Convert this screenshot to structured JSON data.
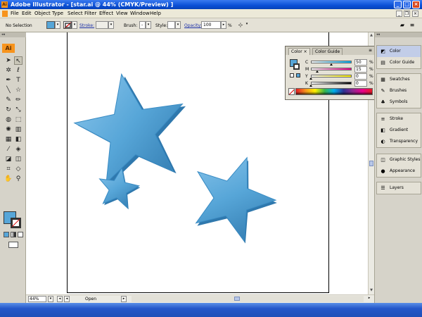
{
  "window": {
    "title": "Adobe Illustrator - [star.ai @ 44% (CMYK/Preview) ]",
    "app_icon_label": "Ai",
    "minimize": "_",
    "maximize": "□",
    "close": "×"
  },
  "menu": {
    "items": [
      "File",
      "Edit",
      "Object",
      "Type",
      "Select",
      "Filter",
      "Effect",
      "View",
      "Window",
      "Help"
    ],
    "doc_minimize": "_",
    "doc_restore": "❐",
    "doc_close": "×"
  },
  "control": {
    "selection": "No Selection",
    "fill_color": "#57a6d8",
    "stroke_label": "Stroke:",
    "brush_label": "Brush:",
    "brush_value": "-",
    "style_label": "Style:",
    "opacity_label": "Opacity:",
    "opacity_value": "100",
    "opacity_unit": "%"
  },
  "tools": {
    "panel_badge": "Ai",
    "collapse": "◂◂"
  },
  "color_panel": {
    "tabs": [
      "Color",
      "Color Guide"
    ],
    "menu_icon": "≡",
    "fill_color": "#57a6d8",
    "channels": [
      {
        "label": "C",
        "value": "50",
        "fraction": 0.5,
        "color": "#00aeef"
      },
      {
        "label": "M",
        "value": "15",
        "fraction": 0.15,
        "color": "#ec008c"
      },
      {
        "label": "Y",
        "value": "0",
        "fraction": 0.0,
        "color": "#fff200"
      },
      {
        "label": "K",
        "value": "0",
        "fraction": 0.0,
        "color": "#000000"
      }
    ],
    "unit": "%"
  },
  "dock": {
    "collapse": "◂◂",
    "groups": [
      [
        "Color",
        "Color Guide"
      ],
      [
        "Swatches",
        "Brushes",
        "Symbols"
      ],
      [
        "Stroke",
        "Gradient",
        "Transparency"
      ],
      [
        "Graphic Styles",
        "Appearance"
      ],
      [
        "Layers"
      ]
    ]
  },
  "status": {
    "zoom": "44%",
    "text": "Open"
  },
  "art": {
    "star_color": "#57a6d8",
    "star_shadow": "#2f78ad",
    "star_highlight": "#8cc6ec"
  }
}
